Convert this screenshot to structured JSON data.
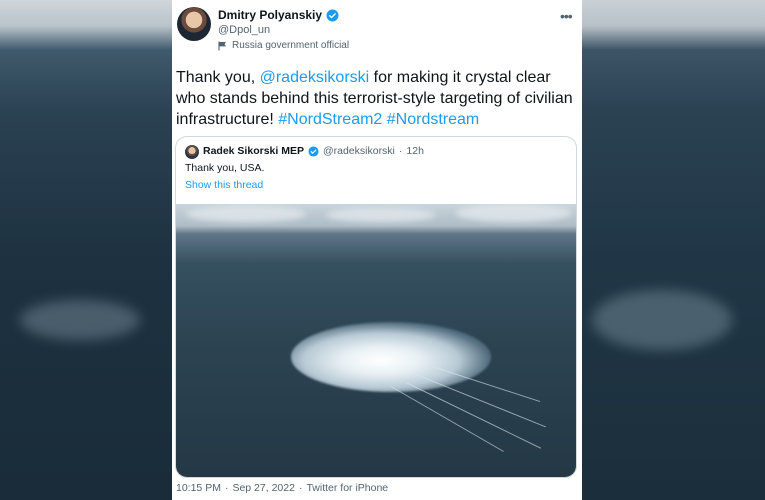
{
  "author": {
    "name": "Dmitry Polyanskiy",
    "handle": "@Dpol_un",
    "label": "Russia government official"
  },
  "icons": {
    "verified": "verified-badge-icon",
    "more": "more-options-icon",
    "label": "flag-icon"
  },
  "tweet": {
    "text_parts": {
      "p1": "Thank you, ",
      "mention": "@radeksikorski",
      "p2": " for making it crystal clear who stands behind this terrorist-style targeting of civilian infrastructure! ",
      "tag1": "#NordStream2",
      "sep": " ",
      "tag2": "#Nordstream"
    }
  },
  "quoted": {
    "name": "Radek Sikorski MEP",
    "handle": "@radeksikorski",
    "dot": "·",
    "time": "12h",
    "text": "Thank you, USA.",
    "show_thread": "Show this thread"
  },
  "footer": {
    "time": "10:15 PM",
    "dot1": "·",
    "date": "Sep 27, 2022",
    "dot2": "·",
    "source": "Twitter for iPhone"
  },
  "colors": {
    "link": "#1d9bf0",
    "text": "#0f1419",
    "muted": "#536471"
  }
}
